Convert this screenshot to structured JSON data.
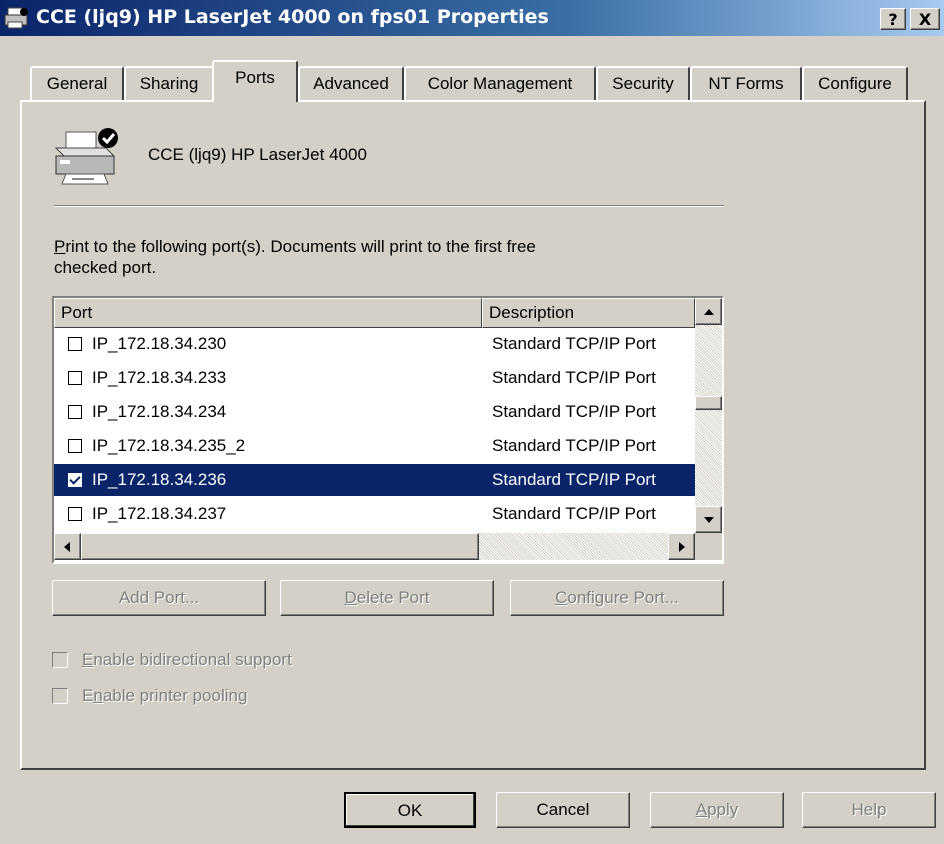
{
  "window": {
    "title": "CCE (ljq9) HP LaserJet 4000 on fps01 Properties",
    "help_button": "?",
    "close_button": "X"
  },
  "tabs": [
    {
      "label": "General",
      "active": false
    },
    {
      "label": "Sharing",
      "active": false
    },
    {
      "label": "Ports",
      "active": true
    },
    {
      "label": "Advanced",
      "active": false
    },
    {
      "label": "Color Management",
      "active": false
    },
    {
      "label": "Security",
      "active": false
    },
    {
      "label": "NT Forms",
      "active": false
    },
    {
      "label": "Configure",
      "active": false
    }
  ],
  "ports_tab": {
    "printer_name": "CCE (ljq9) HP LaserJet 4000",
    "instruction_line1_accel": "P",
    "instruction_line1_rest": "rint to the following port(s). Documents will print to the first free",
    "instruction_line2": "checked port.",
    "columns": {
      "port": "Port",
      "description": "Description"
    },
    "rows": [
      {
        "port": "IP_172.18.34.230",
        "description": "Standard TCP/IP Port",
        "checked": false,
        "selected": false
      },
      {
        "port": "IP_172.18.34.233",
        "description": "Standard TCP/IP Port",
        "checked": false,
        "selected": false
      },
      {
        "port": "IP_172.18.34.234",
        "description": "Standard TCP/IP Port",
        "checked": false,
        "selected": false
      },
      {
        "port": "IP_172.18.34.235_2",
        "description": "Standard TCP/IP Port",
        "checked": false,
        "selected": false
      },
      {
        "port": "IP_172.18.34.236",
        "description": "Standard TCP/IP Port",
        "checked": true,
        "selected": true
      },
      {
        "port": "IP_172.18.34.237",
        "description": "Standard TCP/IP Port",
        "checked": false,
        "selected": false
      }
    ],
    "buttons": {
      "add_port": "Add Port...",
      "delete_port_accel": "D",
      "delete_port_rest": "elete Port",
      "configure_port_accel": "C",
      "configure_port_rest": "onfigure Port..."
    },
    "checkboxes": {
      "bidirectional_accel": "E",
      "bidirectional_rest": "nable bidirectional support",
      "pooling_pre": "E",
      "pooling_accel": "n",
      "pooling_rest": "able printer pooling"
    }
  },
  "footer": {
    "ok": "OK",
    "cancel": "Cancel",
    "apply_accel": "A",
    "apply_rest": "pply",
    "help": "Help"
  },
  "icons": [
    "printer-icon",
    "check-badge-icon",
    "scroll-up-icon",
    "scroll-down-icon",
    "scroll-left-icon",
    "scroll-right-icon"
  ],
  "colors": {
    "selection": "#0a246a",
    "title_start": "#0a246a",
    "title_end": "#a6caf0",
    "face": "#d4d0c8"
  }
}
